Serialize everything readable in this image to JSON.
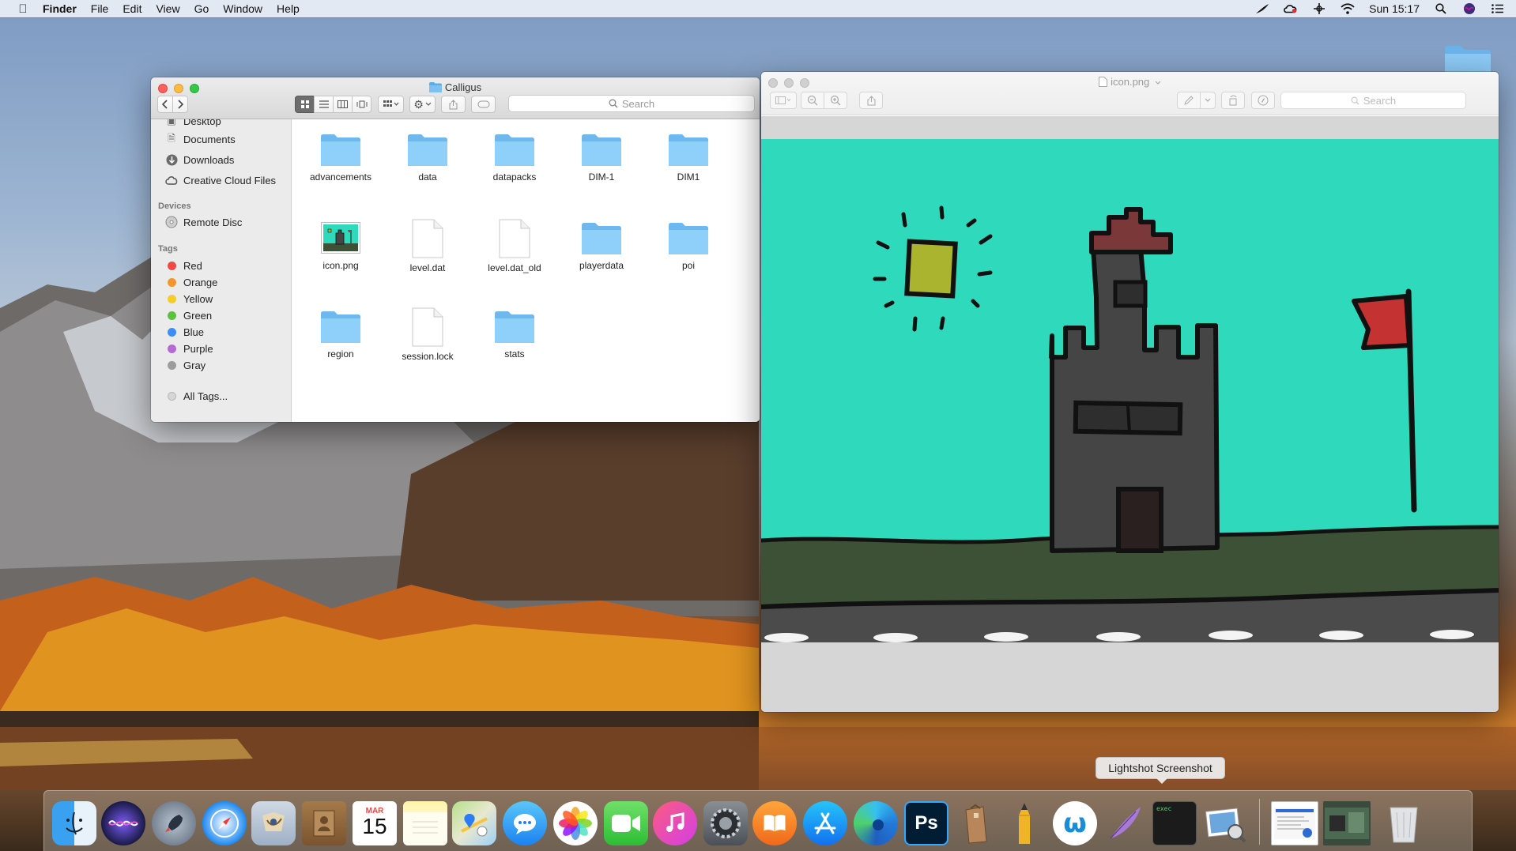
{
  "menubar": {
    "app_name": "Finder",
    "items": [
      "File",
      "Edit",
      "View",
      "Go",
      "Window",
      "Help"
    ],
    "clock": "Sun 15:17"
  },
  "finder": {
    "title": "Calligus",
    "search_placeholder": "Search",
    "sidebar": {
      "favorites": [
        "Desktop",
        "Documents",
        "Downloads",
        "Creative Cloud Files"
      ],
      "devices_header": "Devices",
      "devices": [
        "Remote Disc"
      ],
      "tags_header": "Tags",
      "tags": [
        {
          "label": "Red",
          "color": "#f04a45"
        },
        {
          "label": "Orange",
          "color": "#f5952f"
        },
        {
          "label": "Yellow",
          "color": "#f5cd2b"
        },
        {
          "label": "Green",
          "color": "#5ac240"
        },
        {
          "label": "Blue",
          "color": "#3a8ef5"
        },
        {
          "label": "Purple",
          "color": "#b56ad9"
        },
        {
          "label": "Gray",
          "color": "#9d9d9d"
        }
      ],
      "all_tags": "All Tags..."
    },
    "files": [
      {
        "name": "advancements",
        "kind": "folder"
      },
      {
        "name": "data",
        "kind": "folder"
      },
      {
        "name": "datapacks",
        "kind": "folder"
      },
      {
        "name": "DIM-1",
        "kind": "folder"
      },
      {
        "name": "DIM1",
        "kind": "folder"
      },
      {
        "name": "icon.png",
        "kind": "image"
      },
      {
        "name": "level.dat",
        "kind": "document"
      },
      {
        "name": "level.dat_old",
        "kind": "document"
      },
      {
        "name": "playerdata",
        "kind": "folder"
      },
      {
        "name": "poi",
        "kind": "folder"
      },
      {
        "name": "region",
        "kind": "folder"
      },
      {
        "name": "session.lock",
        "kind": "document"
      },
      {
        "name": "stats",
        "kind": "folder"
      }
    ]
  },
  "preview": {
    "title": "icon.png",
    "search_placeholder": "Search"
  },
  "dock": {
    "tooltip": "Lightshot Screenshot",
    "calendar_month": "MAR",
    "calendar_day": "15",
    "apps": [
      "Finder",
      "Siri",
      "Launchpad",
      "Safari",
      "Mail",
      "Contacts",
      "Calendar",
      "Notes",
      "Maps",
      "Messages",
      "Photos",
      "FaceTime",
      "iTunes",
      "System Preferences",
      "iBooks",
      "App Store",
      "Microsoft Edge",
      "Photoshop",
      "The Unarchiver",
      "Pencil",
      "Lightshot Screenshot",
      "Quill",
      "Terminal",
      "Preview",
      "Recent Document",
      "Recent Document",
      "Trash"
    ]
  }
}
